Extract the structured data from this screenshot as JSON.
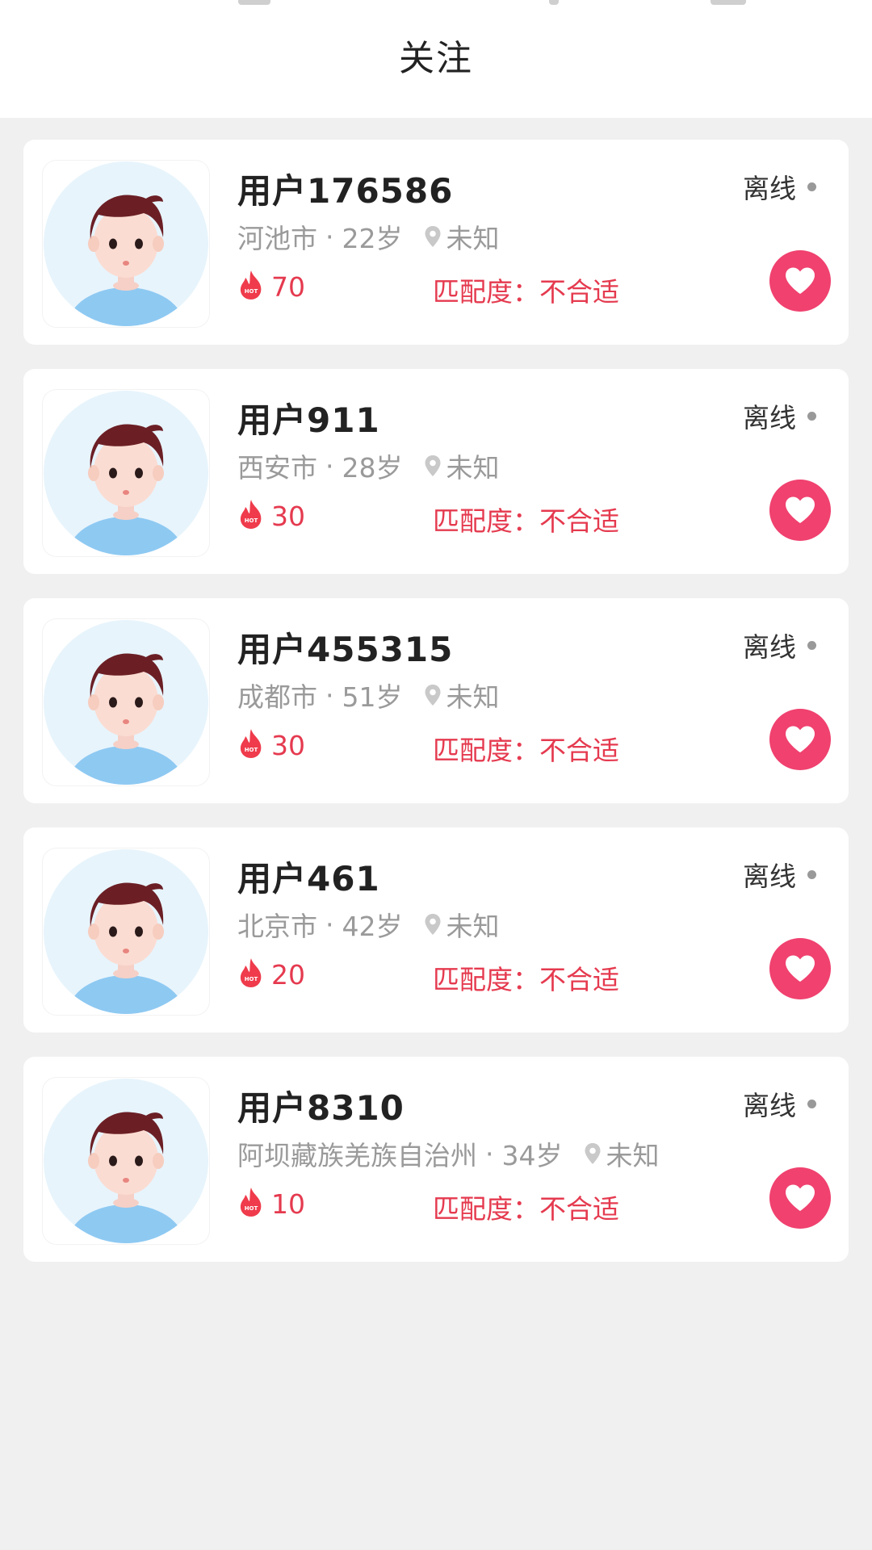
{
  "page": {
    "title": "关注"
  },
  "colors": {
    "accent": "#f0416f",
    "hot_text": "#e53a4f",
    "muted_text": "#9a9a9a",
    "background": "#f0f0f0",
    "offline_dot": "#999999"
  },
  "icons": {
    "hot": "hot-flame-icon",
    "location": "location-pin-icon",
    "like": "heart-icon",
    "avatar": "default-male-avatar"
  },
  "users": [
    {
      "name": "用户176586",
      "city": "河池市",
      "age": "22岁",
      "location": "未知",
      "hot": "70",
      "match": "匹配度：不合适",
      "status": "离线"
    },
    {
      "name": "用户911",
      "city": "西安市",
      "age": "28岁",
      "location": "未知",
      "hot": "30",
      "match": "匹配度：不合适",
      "status": "离线"
    },
    {
      "name": "用户455315",
      "city": "成都市",
      "age": "51岁",
      "location": "未知",
      "hot": "30",
      "match": "匹配度：不合适",
      "status": "离线"
    },
    {
      "name": "用户461",
      "city": "北京市",
      "age": "42岁",
      "location": "未知",
      "hot": "20",
      "match": "匹配度：不合适",
      "status": "离线"
    },
    {
      "name": "用户8310",
      "city": "阿坝藏族羌族自治州",
      "age": "34岁",
      "location": "未知",
      "hot": "10",
      "match": "匹配度：不合适",
      "status": "离线"
    }
  ]
}
